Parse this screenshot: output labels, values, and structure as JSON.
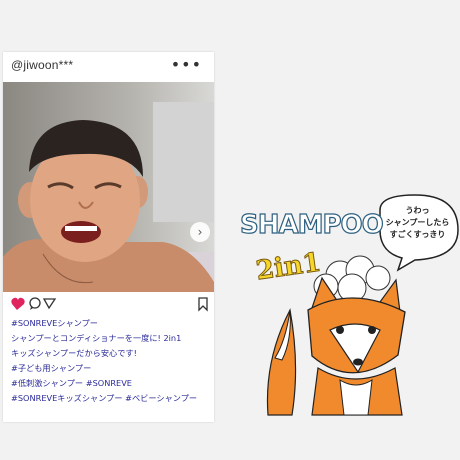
{
  "post": {
    "username": "@jiwoon***",
    "more_icon": "more-horizontal-icon",
    "caption_lines": [
      "#SONREVEシャンプー",
      "シャンプーとコンディショナーを一度に! 2in1",
      "キッズシャンプーだから安心です!",
      "#子ども用シャンプー",
      "#低刺激シャンプー #SONREVE",
      "#SONREVEキッズシャンプー #ベビーシャンプー"
    ],
    "icons": [
      "heart-icon",
      "comment-icon",
      "share-icon",
      "bookmark-icon",
      "chevron-right-icon"
    ]
  },
  "illustration": {
    "title": "SHAMPOO",
    "badge": "2in1",
    "speech_lines": [
      "うわっ",
      "シャンプーしたら",
      "すごくすっきり"
    ],
    "colors": {
      "fox": "#f08a2c",
      "title_outline": "#2d6080",
      "badge": "#f7d62a",
      "heart": "#e0245e"
    }
  }
}
